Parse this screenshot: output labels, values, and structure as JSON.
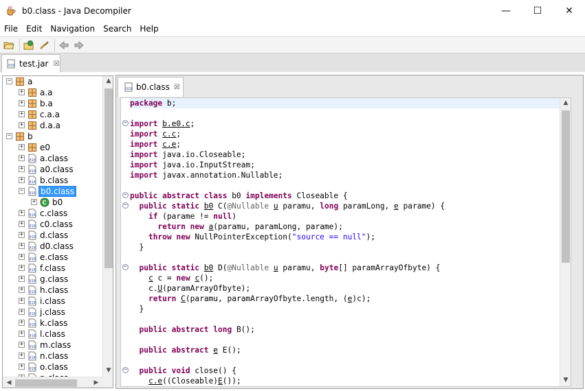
{
  "window": {
    "title": "b0.class - Java Decompiler",
    "controls": {
      "minimize": "—",
      "maximize": "☐",
      "close": "✕"
    }
  },
  "menu": [
    "File",
    "Edit",
    "Navigation",
    "Search",
    "Help"
  ],
  "toolbar": {
    "buttons": [
      "open-file-icon",
      "open-type-icon",
      "search-icon",
      "back-icon",
      "forward-icon"
    ]
  },
  "outer_tab": {
    "label": "test.jar",
    "close": "☒"
  },
  "editor_tab": {
    "label": "b0.class",
    "close": "☒"
  },
  "tree": [
    {
      "depth": 0,
      "toggle": "−",
      "icon": "package",
      "label": "a"
    },
    {
      "depth": 1,
      "toggle": "+",
      "icon": "package",
      "label": "a.a"
    },
    {
      "depth": 1,
      "toggle": "+",
      "icon": "package",
      "label": "b.a"
    },
    {
      "depth": 1,
      "toggle": "+",
      "icon": "package",
      "label": "c.a.a"
    },
    {
      "depth": 1,
      "toggle": "+",
      "icon": "package",
      "label": "d.a.a"
    },
    {
      "depth": 0,
      "toggle": "−",
      "icon": "package",
      "label": "b"
    },
    {
      "depth": 1,
      "toggle": "+",
      "icon": "package",
      "label": "e0"
    },
    {
      "depth": 1,
      "toggle": "+",
      "icon": "class",
      "label": "a.class"
    },
    {
      "depth": 1,
      "toggle": "+",
      "icon": "class",
      "label": "a0.class"
    },
    {
      "depth": 1,
      "toggle": "+",
      "icon": "class",
      "label": "b.class"
    },
    {
      "depth": 1,
      "toggle": "−",
      "icon": "class",
      "label": "b0.class",
      "selected": true
    },
    {
      "depth": 2,
      "toggle": "+",
      "icon": "abstract-class",
      "label": "b0"
    },
    {
      "depth": 1,
      "toggle": "+",
      "icon": "class",
      "label": "c.class"
    },
    {
      "depth": 1,
      "toggle": "+",
      "icon": "class",
      "label": "c0.class"
    },
    {
      "depth": 1,
      "toggle": "+",
      "icon": "class",
      "label": "d.class"
    },
    {
      "depth": 1,
      "toggle": "+",
      "icon": "class",
      "label": "d0.class"
    },
    {
      "depth": 1,
      "toggle": "+",
      "icon": "class",
      "label": "e.class"
    },
    {
      "depth": 1,
      "toggle": "+",
      "icon": "class",
      "label": "f.class"
    },
    {
      "depth": 1,
      "toggle": "+",
      "icon": "class",
      "label": "g.class"
    },
    {
      "depth": 1,
      "toggle": "+",
      "icon": "class",
      "label": "h.class"
    },
    {
      "depth": 1,
      "toggle": "+",
      "icon": "class",
      "label": "i.class"
    },
    {
      "depth": 1,
      "toggle": "+",
      "icon": "class",
      "label": "j.class"
    },
    {
      "depth": 1,
      "toggle": "+",
      "icon": "class",
      "label": "k.class"
    },
    {
      "depth": 1,
      "toggle": "+",
      "icon": "class",
      "label": "l.class"
    },
    {
      "depth": 1,
      "toggle": "+",
      "icon": "class",
      "label": "m.class"
    },
    {
      "depth": 1,
      "toggle": "+",
      "icon": "class",
      "label": "n.class"
    },
    {
      "depth": 1,
      "toggle": "+",
      "icon": "class",
      "label": "o.class"
    },
    {
      "depth": 1,
      "toggle": "+",
      "icon": "class",
      "label": "p.class"
    }
  ],
  "code": [
    {
      "fold": "",
      "current": true,
      "tokens": [
        [
          "kw",
          "package"
        ],
        [
          "t",
          " b;"
        ]
      ]
    },
    {
      "fold": "",
      "tokens": []
    },
    {
      "fold": "−",
      "tokens": [
        [
          "kw",
          "import"
        ],
        [
          "t",
          " "
        ],
        [
          "ul",
          "b.e0.c"
        ],
        [
          "t",
          ";"
        ]
      ]
    },
    {
      "fold": "",
      "tokens": [
        [
          "kw",
          "import"
        ],
        [
          "t",
          " "
        ],
        [
          "ul",
          "c.c"
        ],
        [
          "t",
          ";"
        ]
      ]
    },
    {
      "fold": "",
      "tokens": [
        [
          "kw",
          "import"
        ],
        [
          "t",
          " "
        ],
        [
          "ul",
          "c.e"
        ],
        [
          "t",
          ";"
        ]
      ]
    },
    {
      "fold": "",
      "tokens": [
        [
          "kw",
          "import"
        ],
        [
          "t",
          " java.io.Closeable;"
        ]
      ]
    },
    {
      "fold": "",
      "tokens": [
        [
          "kw",
          "import"
        ],
        [
          "t",
          " java.io.InputStream;"
        ]
      ]
    },
    {
      "fold": "",
      "tokens": [
        [
          "kw",
          "import"
        ],
        [
          "t",
          " javax.annotation.Nullable;"
        ]
      ]
    },
    {
      "fold": "",
      "tokens": []
    },
    {
      "fold": "−",
      "tokens": [
        [
          "kw",
          "public abstract class"
        ],
        [
          "t",
          " b0 "
        ],
        [
          "kw",
          "implements"
        ],
        [
          "t",
          " Closeable {"
        ]
      ]
    },
    {
      "fold": "−",
      "tokens": [
        [
          "t",
          "  "
        ],
        [
          "kw",
          "public static"
        ],
        [
          "t",
          " "
        ],
        [
          "ul",
          "b0"
        ],
        [
          "t",
          " C("
        ],
        [
          "ann",
          "@Nullable"
        ],
        [
          "t",
          " "
        ],
        [
          "ul",
          "u"
        ],
        [
          "t",
          " paramu, "
        ],
        [
          "kw",
          "long"
        ],
        [
          "t",
          " paramLong, "
        ],
        [
          "ul",
          "e"
        ],
        [
          "t",
          " parame) {"
        ]
      ]
    },
    {
      "fold": "",
      "tokens": [
        [
          "t",
          "    "
        ],
        [
          "kw",
          "if"
        ],
        [
          "t",
          " (parame != "
        ],
        [
          "kw",
          "null"
        ],
        [
          "t",
          ")"
        ]
      ]
    },
    {
      "fold": "",
      "tokens": [
        [
          "t",
          "      "
        ],
        [
          "kw",
          "return new"
        ],
        [
          "t",
          " "
        ],
        [
          "ul",
          "a"
        ],
        [
          "t",
          "(paramu, paramLong, parame);"
        ]
      ]
    },
    {
      "fold": "",
      "tokens": [
        [
          "t",
          "    "
        ],
        [
          "kw",
          "throw new"
        ],
        [
          "t",
          " NullPointerException("
        ],
        [
          "str",
          "\"source == null\""
        ],
        [
          "t",
          ");"
        ]
      ]
    },
    {
      "fold": "",
      "tokens": [
        [
          "t",
          "  }"
        ]
      ]
    },
    {
      "fold": "",
      "tokens": []
    },
    {
      "fold": "−",
      "tokens": [
        [
          "t",
          "  "
        ],
        [
          "kw",
          "public static"
        ],
        [
          "t",
          " "
        ],
        [
          "ul",
          "b0"
        ],
        [
          "t",
          " D("
        ],
        [
          "ann",
          "@Nullable"
        ],
        [
          "t",
          " "
        ],
        [
          "ul",
          "u"
        ],
        [
          "t",
          " paramu, "
        ],
        [
          "kw",
          "byte"
        ],
        [
          "t",
          "[] paramArrayOfbyte) {"
        ]
      ]
    },
    {
      "fold": "",
      "tokens": [
        [
          "t",
          "    "
        ],
        [
          "ul",
          "c"
        ],
        [
          "t",
          " c = "
        ],
        [
          "kw",
          "new"
        ],
        [
          "t",
          " "
        ],
        [
          "ul",
          "c"
        ],
        [
          "t",
          "();"
        ]
      ]
    },
    {
      "fold": "",
      "tokens": [
        [
          "t",
          "    c."
        ],
        [
          "ul",
          "U"
        ],
        [
          "t",
          "(paramArrayOfbyte);"
        ]
      ]
    },
    {
      "fold": "",
      "tokens": [
        [
          "t",
          "    "
        ],
        [
          "kw",
          "return"
        ],
        [
          "t",
          " "
        ],
        [
          "ul",
          "C"
        ],
        [
          "t",
          "(paramu, paramArrayOfbyte.length, ("
        ],
        [
          "ul",
          "e"
        ],
        [
          "t",
          ")c);"
        ]
      ]
    },
    {
      "fold": "",
      "tokens": [
        [
          "t",
          "  }"
        ]
      ]
    },
    {
      "fold": "",
      "tokens": []
    },
    {
      "fold": "",
      "tokens": [
        [
          "t",
          "  "
        ],
        [
          "kw",
          "public abstract long"
        ],
        [
          "t",
          " B();"
        ]
      ]
    },
    {
      "fold": "",
      "tokens": []
    },
    {
      "fold": "",
      "tokens": [
        [
          "t",
          "  "
        ],
        [
          "kw",
          "public abstract"
        ],
        [
          "t",
          " "
        ],
        [
          "ul",
          "e"
        ],
        [
          "t",
          " E();"
        ]
      ]
    },
    {
      "fold": "",
      "tokens": []
    },
    {
      "fold": "−",
      "tokens": [
        [
          "t",
          "  "
        ],
        [
          "kw",
          "public void"
        ],
        [
          "t",
          " close() {"
        ]
      ]
    },
    {
      "fold": "",
      "tokens": [
        [
          "t",
          "    "
        ],
        [
          "ul",
          "c.e"
        ],
        [
          "t",
          "((Closeable)"
        ],
        [
          "ul",
          "E"
        ],
        [
          "t",
          "());"
        ]
      ]
    }
  ],
  "colors": {
    "keyword": "#7f0055",
    "string": "#2a00ff",
    "annotation": "#646464",
    "selection": "#3399ff"
  }
}
